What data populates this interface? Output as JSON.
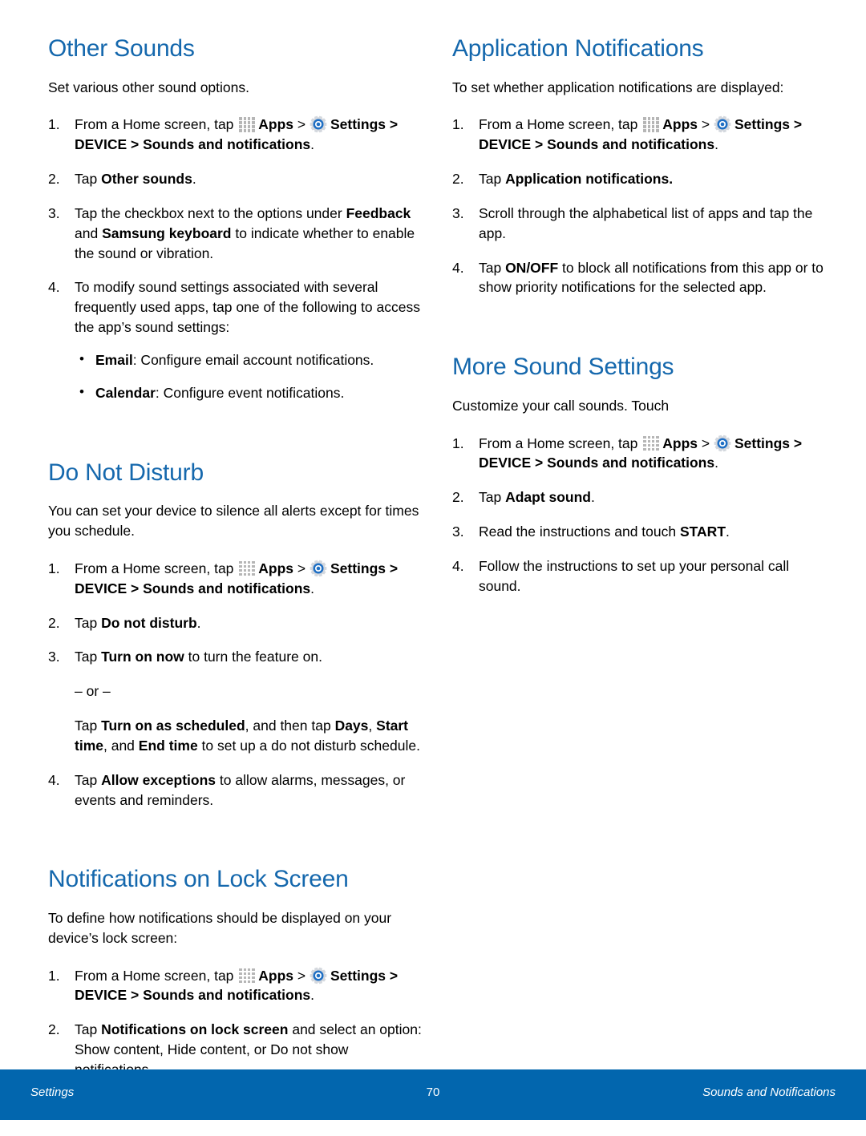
{
  "document": {
    "type": "user-manual-page",
    "accent_heading_color": "#1568ad",
    "footer_bar_color": "#0266ae",
    "icons": {
      "apps": "apps-grid-icon",
      "settings": "settings-gear-icon"
    }
  },
  "left_column": {
    "sections": [
      {
        "title": "Other Sounds",
        "intro": "Set various other sound options.",
        "steps": [
          {
            "num": "1.",
            "parts": [
              {
                "t": "text",
                "v": "From a Home screen, tap "
              },
              {
                "t": "icon",
                "v": "apps"
              },
              {
                "t": "bold",
                "v": "Apps"
              },
              {
                "t": "text",
                "v": " > "
              },
              {
                "t": "icon",
                "v": "settings"
              },
              {
                "t": "bold",
                "v": "Settings > DEVICE > Sounds and notifications"
              },
              {
                "t": "text",
                "v": "."
              }
            ]
          },
          {
            "num": "2.",
            "parts": [
              {
                "t": "text",
                "v": "Tap "
              },
              {
                "t": "bold",
                "v": "Other sounds"
              },
              {
                "t": "text",
                "v": "."
              }
            ]
          },
          {
            "num": "3.",
            "parts": [
              {
                "t": "text",
                "v": "Tap the checkbox next to the options under "
              },
              {
                "t": "bold",
                "v": "Feedback"
              },
              {
                "t": "text",
                "v": " and "
              },
              {
                "t": "bold",
                "v": "Samsung keyboard"
              },
              {
                "t": "text",
                "v": " to indicate whether to enable the sound or vibration."
              }
            ]
          },
          {
            "num": "4.",
            "parts": [
              {
                "t": "text",
                "v": "To modify sound settings associated with several frequently used apps, tap one of the following to access the app’s sound settings:"
              }
            ],
            "bullets": [
              [
                {
                  "t": "bold",
                  "v": "Email"
                },
                {
                  "t": "text",
                  "v": ": Configure email account notifications."
                }
              ],
              [
                {
                  "t": "bold",
                  "v": "Calendar"
                },
                {
                  "t": "text",
                  "v": ": Configure event notifications."
                }
              ]
            ]
          }
        ]
      },
      {
        "title": "Do Not Disturb",
        "intro": "You can set your device to silence all alerts except for times you schedule.",
        "steps": [
          {
            "num": "1.",
            "parts": [
              {
                "t": "text",
                "v": "From a Home screen, tap "
              },
              {
                "t": "icon",
                "v": "apps"
              },
              {
                "t": "bold",
                "v": "Apps"
              },
              {
                "t": "text",
                "v": " > "
              },
              {
                "t": "icon",
                "v": "settings"
              },
              {
                "t": "bold",
                "v": "Settings > DEVICE > Sounds and notifications"
              },
              {
                "t": "text",
                "v": "."
              }
            ]
          },
          {
            "num": "2.",
            "parts": [
              {
                "t": "text",
                "v": "Tap "
              },
              {
                "t": "bold",
                "v": "Do not disturb"
              },
              {
                "t": "text",
                "v": "."
              }
            ]
          },
          {
            "num": "3.",
            "parts": [
              {
                "t": "text",
                "v": "Tap "
              },
              {
                "t": "bold",
                "v": "Turn on now"
              },
              {
                "t": "text",
                "v": " to turn the feature on."
              }
            ],
            "or_separator": "– or –",
            "alt_parts": [
              {
                "t": "text",
                "v": "Tap "
              },
              {
                "t": "bold",
                "v": "Turn on as scheduled"
              },
              {
                "t": "text",
                "v": ", and then tap "
              },
              {
                "t": "bold",
                "v": "Days"
              },
              {
                "t": "text",
                "v": ", "
              },
              {
                "t": "bold",
                "v": "Start time"
              },
              {
                "t": "text",
                "v": ", and "
              },
              {
                "t": "bold",
                "v": "End time"
              },
              {
                "t": "text",
                "v": " to set up a do not disturb schedule."
              }
            ]
          },
          {
            "num": "4.",
            "parts": [
              {
                "t": "text",
                "v": "Tap "
              },
              {
                "t": "bold",
                "v": "Allow exceptions"
              },
              {
                "t": "text",
                "v": " to allow alarms, messages, or events and reminders."
              }
            ]
          }
        ]
      },
      {
        "title": "Notifications on Lock Screen",
        "intro": "To define how notifications should be displayed on your device’s lock screen:",
        "steps": [
          {
            "num": "1.",
            "parts": [
              {
                "t": "text",
                "v": "From a Home screen, tap "
              },
              {
                "t": "icon",
                "v": "apps"
              },
              {
                "t": "bold",
                "v": "Apps"
              },
              {
                "t": "text",
                "v": " > "
              },
              {
                "t": "icon",
                "v": "settings"
              },
              {
                "t": "bold",
                "v": "Settings > DEVICE > Sounds and notifications"
              },
              {
                "t": "text",
                "v": "."
              }
            ]
          },
          {
            "num": "2.",
            "parts": [
              {
                "t": "text",
                "v": "Tap "
              },
              {
                "t": "bold",
                "v": "Notifications on lock screen"
              },
              {
                "t": "text",
                "v": " and select an option: Show content, Hide content, or Do not show notifications."
              }
            ]
          }
        ]
      }
    ]
  },
  "right_column": {
    "sections": [
      {
        "title": "Application Notifications",
        "intro": "To set whether application notifications are displayed:",
        "steps": [
          {
            "num": "1.",
            "parts": [
              {
                "t": "text",
                "v": "From a Home screen, tap "
              },
              {
                "t": "icon",
                "v": "apps"
              },
              {
                "t": "bold",
                "v": "Apps"
              },
              {
                "t": "text",
                "v": " > "
              },
              {
                "t": "icon",
                "v": "settings"
              },
              {
                "t": "bold",
                "v": "Settings > DEVICE > Sounds and notifications"
              },
              {
                "t": "text",
                "v": "."
              }
            ]
          },
          {
            "num": "2.",
            "parts": [
              {
                "t": "text",
                "v": "Tap "
              },
              {
                "t": "bold",
                "v": "Application notifications."
              }
            ]
          },
          {
            "num": "3.",
            "parts": [
              {
                "t": "text",
                "v": "Scroll through the alphabetical list of apps and tap the app."
              }
            ]
          },
          {
            "num": "4.",
            "parts": [
              {
                "t": "text",
                "v": "Tap "
              },
              {
                "t": "bold",
                "v": "ON/OFF"
              },
              {
                "t": "text",
                "v": " to block all notifications from this app or to show priority notifications for the selected app."
              }
            ]
          }
        ]
      },
      {
        "title": "More Sound Settings",
        "intro": "Customize your call sounds. Touch",
        "steps": [
          {
            "num": "1.",
            "parts": [
              {
                "t": "text",
                "v": "From a Home screen, tap "
              },
              {
                "t": "icon",
                "v": "apps"
              },
              {
                "t": "bold",
                "v": "Apps"
              },
              {
                "t": "text",
                "v": " > "
              },
              {
                "t": "icon",
                "v": "settings"
              },
              {
                "t": "bold",
                "v": "Settings > DEVICE > Sounds and notifications"
              },
              {
                "t": "text",
                "v": "."
              }
            ]
          },
          {
            "num": "2.",
            "parts": [
              {
                "t": "text",
                "v": "Tap "
              },
              {
                "t": "bold",
                "v": "Adapt sound"
              },
              {
                "t": "text",
                "v": "."
              }
            ]
          },
          {
            "num": "3.",
            "parts": [
              {
                "t": "text",
                "v": "Read the instructions and touch "
              },
              {
                "t": "bold",
                "v": "START"
              },
              {
                "t": "text",
                "v": "."
              }
            ]
          },
          {
            "num": "4.",
            "parts": [
              {
                "t": "text",
                "v": "Follow the instructions to set up your personal call sound."
              }
            ]
          }
        ]
      }
    ]
  },
  "footer": {
    "left": "Settings",
    "page_number": "70",
    "right": "Sounds and Notifications"
  }
}
